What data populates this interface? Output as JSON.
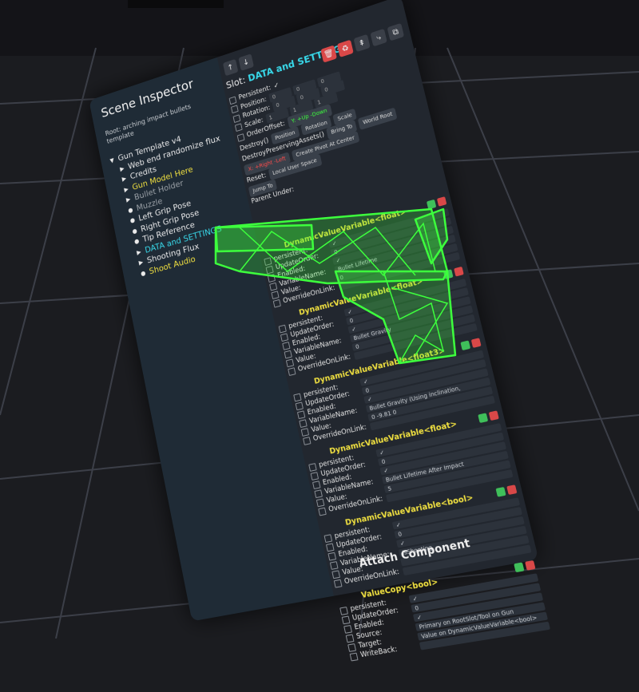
{
  "colors": {
    "background": "#1b1c20",
    "panel": "#22272f",
    "tree_bg": "#1f2b36",
    "accent_cyan": "#38d9ea",
    "component_yellow": "#f0e040",
    "gun_green": "#3dff3d",
    "close_red": "#e84c3d"
  },
  "window": {
    "title": "Scene Inspector",
    "root_label": "Root: arching impact bullets template"
  },
  "tree": [
    {
      "label": "Gun Template v4",
      "level": 0,
      "icon": "triangle-down",
      "color": "#e9e9ea"
    },
    {
      "label": "Web end randomize flux",
      "level": 1,
      "icon": "triangle-right",
      "color": "#e9e9ea"
    },
    {
      "label": "Credits",
      "level": 1,
      "icon": "triangle-right",
      "color": "#e9e9ea"
    },
    {
      "label": "Gun Model Here",
      "level": 1,
      "icon": "triangle-right",
      "color": "#f0e040"
    },
    {
      "label": "Bullet Holder",
      "level": 1,
      "icon": "triangle-right",
      "color": "#9aa0a6"
    },
    {
      "label": "Muzzle",
      "level": 1,
      "icon": "dot",
      "color": "#9aa0a6"
    },
    {
      "label": "Left Grip Pose",
      "level": 1,
      "icon": "dot",
      "color": "#e9e9ea"
    },
    {
      "label": "Right Grip Pose",
      "level": 1,
      "icon": "dot",
      "color": "#e9e9ea"
    },
    {
      "label": "Tip Reference",
      "level": 1,
      "icon": "dot",
      "color": "#e9e9ea"
    },
    {
      "label": "DATA and SETTINGS",
      "level": 1,
      "icon": "triangle-right",
      "color": "#38d9ea"
    },
    {
      "label": "Shooting Flux",
      "level": 1,
      "icon": "triangle-right",
      "color": "#e9e9ea"
    },
    {
      "label": "Shoot Audio",
      "level": 1,
      "icon": "dot",
      "color": "#f0e040"
    }
  ],
  "slot": {
    "key": "Slot:",
    "value": "DATA and SETTINGS"
  },
  "transform": {
    "persistent": "Persistent:",
    "position": "Position:",
    "rotation": "Rotation:",
    "scale": "Scale:",
    "order_offset": "OrderOffset:",
    "destroy": "Destroy()",
    "destroy_preserving": "DestroyPreservingAssets()",
    "reset": "Reset:",
    "position_vals": [
      "0",
      "0",
      "0"
    ],
    "rotation_vals": [
      "0",
      "0",
      "0"
    ],
    "scale_vals": [
      "1",
      "1",
      "1"
    ],
    "axis_x": "X",
    "axis_y": "Y",
    "axis_z": "Z",
    "order_val": "0",
    "up_down": "Y: +Up -Down",
    "right_left": "X: +Right -Left",
    "btn_position": "Position",
    "btn_rotation": "Rotation",
    "btn_scale": "Scale",
    "btn_bring_to": "Bring To",
    "btn_world_root": "World Root",
    "btn_create_pivot": "Create Pivot At Center",
    "btn_jump_to": "Jump To",
    "btn_local_user_space": "Local User Space",
    "parent_under": "Parent Under:"
  },
  "components": [
    {
      "title": "DynamicValueVariable<float>",
      "fields": [
        {
          "label": "persistent:",
          "value": "✓"
        },
        {
          "label": "UpdateOrder:",
          "value": "0"
        },
        {
          "label": "Enabled:",
          "value": "✓"
        },
        {
          "label": "VariableName:",
          "value": "Bullet Lifetime"
        },
        {
          "label": "Value:",
          "value": "0"
        },
        {
          "label": "OverrideOnLink:",
          "value": ""
        }
      ]
    },
    {
      "title": "DynamicValueVariable<float>",
      "fields": [
        {
          "label": "persistent:",
          "value": "✓"
        },
        {
          "label": "UpdateOrder:",
          "value": "0"
        },
        {
          "label": "Enabled:",
          "value": "✓"
        },
        {
          "label": "VariableName:",
          "value": "Bullet Gravity"
        },
        {
          "label": "Value:",
          "value": "0"
        },
        {
          "label": "OverrideOnLink:",
          "value": ""
        }
      ]
    },
    {
      "title": "DynamicValueVariable<float3>",
      "fields": [
        {
          "label": "persistent:",
          "value": "✓"
        },
        {
          "label": "UpdateOrder:",
          "value": "0"
        },
        {
          "label": "Enabled:",
          "value": "✓"
        },
        {
          "label": "VariableName:",
          "value": "Bullet Gravity (Using inclination, Velocity+Weight)"
        },
        {
          "label": "Value:",
          "value": "0   -9.81   0"
        },
        {
          "label": "OverrideOnLink:",
          "value": ""
        }
      ]
    },
    {
      "title": "DynamicValueVariable<float>",
      "fields": [
        {
          "label": "persistent:",
          "value": "✓"
        },
        {
          "label": "UpdateOrder:",
          "value": "0"
        },
        {
          "label": "Enabled:",
          "value": "✓"
        },
        {
          "label": "VariableName:",
          "value": "Bullet Lifetime After Impact"
        },
        {
          "label": "Value:",
          "value": "5"
        },
        {
          "label": "OverrideOnLink:",
          "value": ""
        }
      ]
    },
    {
      "title": "DynamicValueVariable<bool>",
      "fields": [
        {
          "label": "persistent:",
          "value": "✓"
        },
        {
          "label": "UpdateOrder:",
          "value": "0"
        },
        {
          "label": "Enabled:",
          "value": "✓"
        },
        {
          "label": "VariableName:",
          "value": "IsShooting"
        },
        {
          "label": "Value:",
          "value": ""
        },
        {
          "label": "OverrideOnLink:",
          "value": ""
        }
      ]
    },
    {
      "title": "ValueCopy<bool>",
      "fields": [
        {
          "label": "persistent:",
          "value": "✓"
        },
        {
          "label": "UpdateOrder:",
          "value": "0"
        },
        {
          "label": "Enabled:",
          "value": "✓"
        },
        {
          "label": "Source:",
          "value": "Primary on RootSlot/Tool on Gun Template v4 (ID: 1234...)"
        },
        {
          "label": "Target:",
          "value": "Value on DynamicValueVariable<bool> on DATA AND SETTINGS"
        },
        {
          "label": "WriteBack:",
          "value": ""
        }
      ]
    }
  ],
  "attach_label": "Attach Component"
}
